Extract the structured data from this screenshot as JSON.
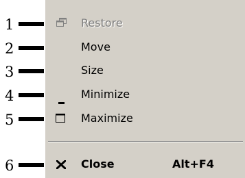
{
  "callouts": [
    "1",
    "2",
    "3",
    "4",
    "5",
    "6"
  ],
  "menu": {
    "items": [
      {
        "label": "Restore",
        "icon": "restore-icon",
        "enabled": false
      },
      {
        "label": "Move",
        "icon": null,
        "enabled": true
      },
      {
        "label": "Size",
        "icon": null,
        "enabled": true
      },
      {
        "label": "Minimize",
        "icon": "minimize-icon",
        "enabled": true
      },
      {
        "label": "Maximize",
        "icon": "maximize-icon",
        "enabled": true
      },
      {
        "label": "Close",
        "icon": "close-icon",
        "enabled": true,
        "shortcut": "Alt+F4",
        "bold": true
      }
    ]
  },
  "colors": {
    "menu_bg": "#d4d0c8",
    "disabled_text": "#808080",
    "text": "#000000"
  }
}
